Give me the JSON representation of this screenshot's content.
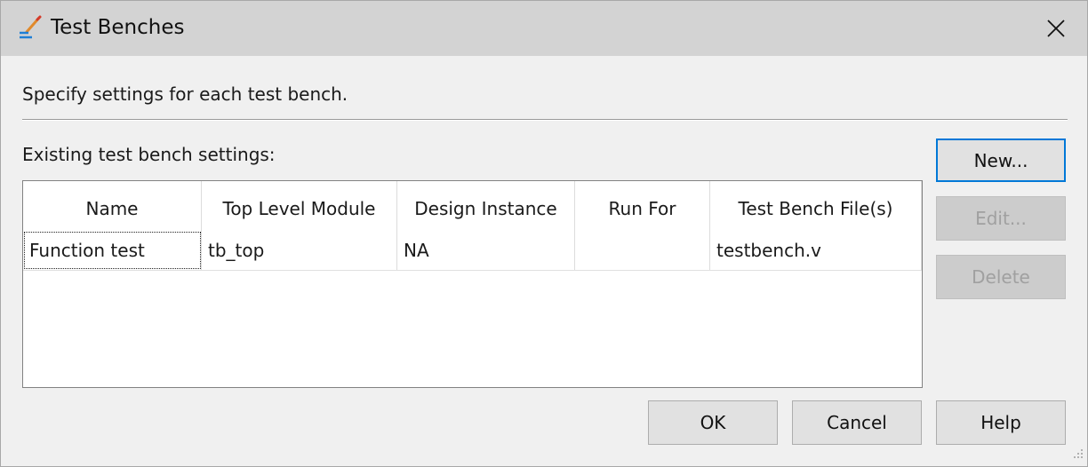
{
  "window": {
    "title": "Test Benches",
    "icon": "quartus-edit-icon"
  },
  "instructions": "Specify settings for each test bench.",
  "existing_label": "Existing test bench settings:",
  "table": {
    "columns": [
      "Name",
      "Top Level Module",
      "Design Instance",
      "Run For",
      "Test Bench File(s)"
    ],
    "rows": [
      [
        "Function test",
        "tb_top",
        "NA",
        "",
        "testbench.v"
      ]
    ]
  },
  "side_buttons": {
    "new": "New...",
    "edit": "Edit...",
    "delete": "Delete"
  },
  "bottom_buttons": {
    "ok": "OK",
    "cancel": "Cancel",
    "help": "Help"
  },
  "colors": {
    "titlebar": "#d3d3d3",
    "accent": "#0078d7"
  }
}
